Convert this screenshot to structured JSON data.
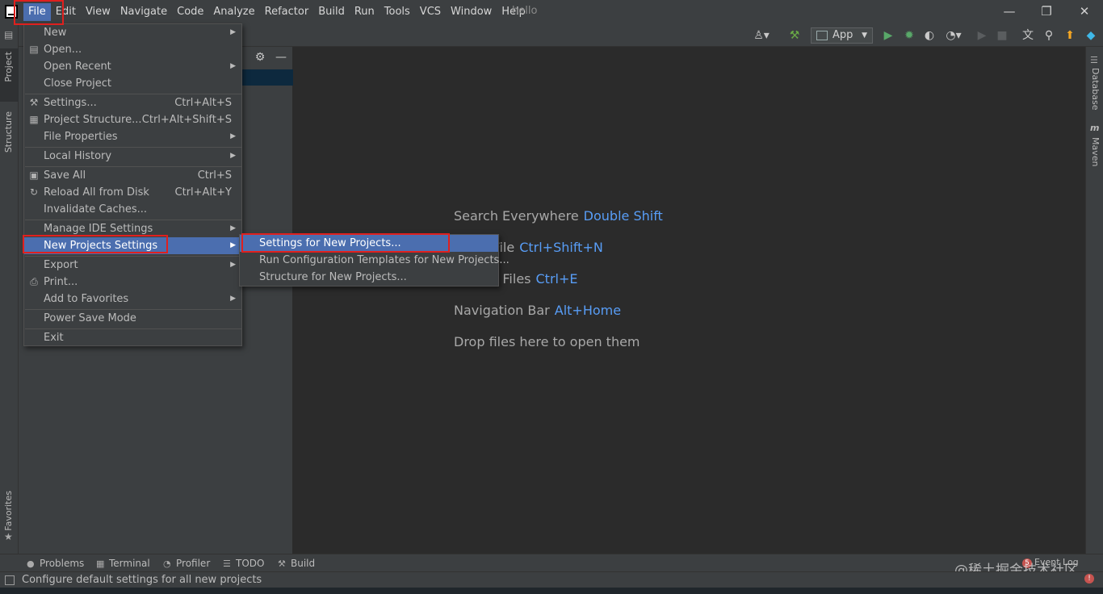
{
  "window": {
    "title": "hello",
    "minimize": "—",
    "restore": "❐",
    "close": "✕"
  },
  "menubar": [
    "File",
    "Edit",
    "View",
    "Navigate",
    "Code",
    "Analyze",
    "Refactor",
    "Build",
    "Run",
    "Tools",
    "VCS",
    "Window",
    "Help"
  ],
  "toolbar": {
    "run_config": "App"
  },
  "left_tabs": {
    "project": "Project",
    "structure": "Structure",
    "favorites": "Favorites"
  },
  "right_tabs": {
    "database": "Database",
    "maven": "Maven"
  },
  "file_menu": {
    "new": "New",
    "open": "Open...",
    "open_recent": "Open Recent",
    "close_project": "Close Project",
    "settings": "Settings...",
    "settings_shortcut": "Ctrl+Alt+S",
    "project_structure": "Project Structure...",
    "project_structure_shortcut": "Ctrl+Alt+Shift+S",
    "file_properties": "File Properties",
    "local_history": "Local History",
    "save_all": "Save All",
    "save_all_shortcut": "Ctrl+S",
    "reload_all": "Reload All from Disk",
    "reload_all_shortcut": "Ctrl+Alt+Y",
    "invalidate_caches": "Invalidate Caches...",
    "manage_ide_settings": "Manage IDE Settings",
    "new_projects_settings": "New Projects Settings",
    "export": "Export",
    "print": "Print...",
    "add_to_favorites": "Add to Favorites",
    "power_save_mode": "Power Save Mode",
    "exit": "Exit"
  },
  "submenu": {
    "settings_for_new": "Settings for New Projects...",
    "run_config_templates": "Run Configuration Templates for New Projects...",
    "structure_for_new": "Structure for New Projects..."
  },
  "editor_hints": [
    {
      "label": "Search Everywhere",
      "key": "Double Shift"
    },
    {
      "label": "Go to File",
      "key": "Ctrl+Shift+N"
    },
    {
      "label": "Recent Files",
      "key": "Ctrl+E"
    },
    {
      "label": "Navigation Bar",
      "key": "Alt+Home"
    },
    {
      "label": "Drop files here to open them",
      "key": ""
    }
  ],
  "bottom_tools": {
    "problems": "Problems",
    "terminal": "Terminal",
    "profiler": "Profiler",
    "todo": "TODO",
    "build": "Build"
  },
  "event_log": {
    "label": "Event Log",
    "count": "5"
  },
  "status": {
    "text": "Configure default settings for all new projects"
  },
  "watermark": "@稀土掘金技术社区",
  "icons": {
    "open": "▤",
    "settings": "⚒",
    "project_structure": "▦",
    "save": "▣",
    "reload": "↻",
    "print": "⎙",
    "submenu_arrow": "▶",
    "gear": "⚙",
    "minus": "—"
  }
}
